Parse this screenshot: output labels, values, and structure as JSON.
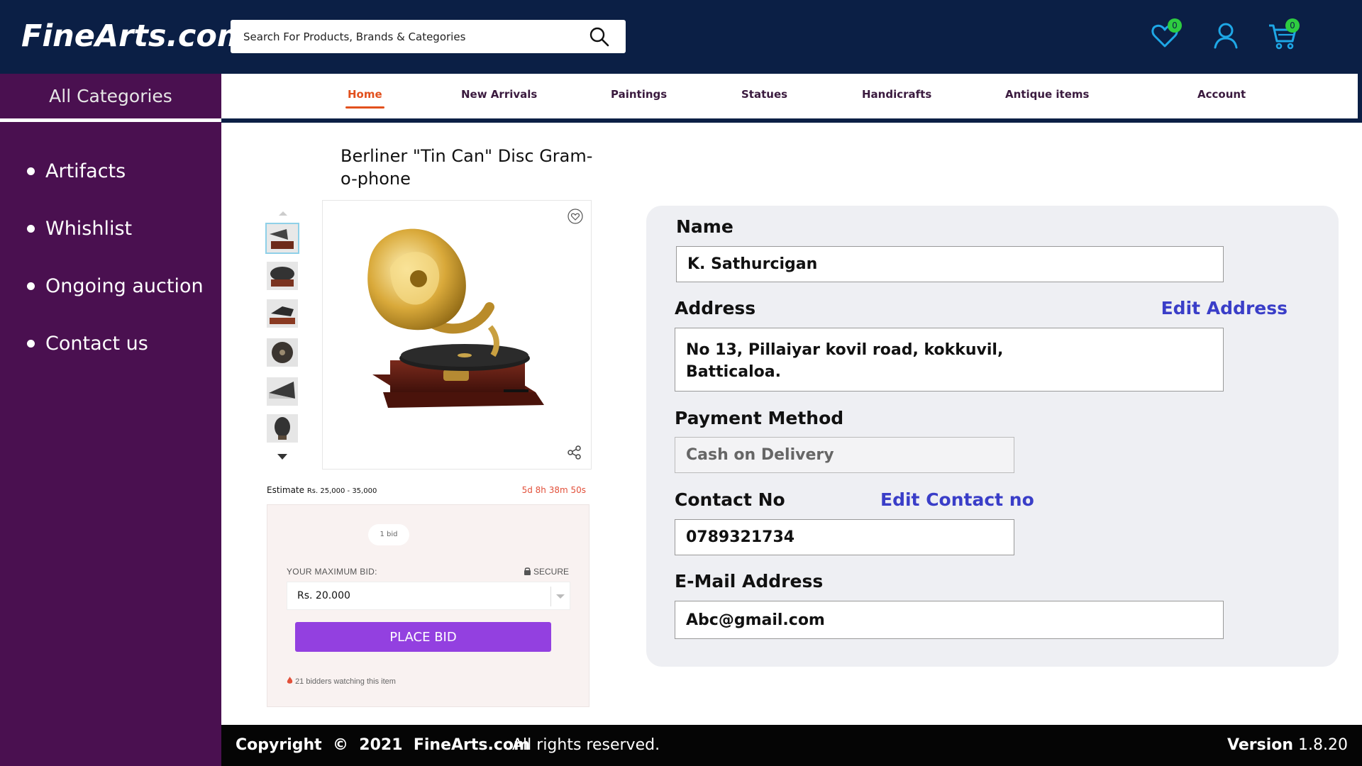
{
  "header": {
    "logo": "FineArts.com",
    "search_placeholder": "Search For Products, Brands & Categories",
    "wishlist_count": "0",
    "cart_count": "0"
  },
  "sidebar": {
    "all_categories": "All Categories",
    "items": [
      {
        "label": "Artifacts"
      },
      {
        "label": "Whishlist"
      },
      {
        "label": "Ongoing auction"
      },
      {
        "label": "Contact us"
      }
    ]
  },
  "nav": {
    "items": [
      {
        "label": "Home",
        "active": true
      },
      {
        "label": "New Arrivals"
      },
      {
        "label": "Paintings"
      },
      {
        "label": "Statues"
      },
      {
        "label": "Handicrafts"
      },
      {
        "label": "Antique items"
      },
      {
        "label": "Account"
      }
    ]
  },
  "product": {
    "title": "Berliner \"Tin Can\" Disc Gram-o-phone",
    "estimate_label": "Estimate",
    "estimate_value": "Rs. 25,000 - 35,000",
    "time_left": "5d 8h 38m 50s",
    "bids": "1 bid",
    "max_bid_label": "YOUR MAXIMUM BID:",
    "secure_label": "SECURE",
    "max_bid_value": "Rs. 20.000",
    "place_bid": "PLACE BID",
    "watching": "21 bidders watching this item"
  },
  "form": {
    "name_label": "Name",
    "name_value": "K. Sathurcigan",
    "address_label": "Address",
    "edit_address": "Edit Address",
    "address_line1": "No 13, Pillaiyar kovil road, kokkuvil,",
    "address_line2": "Batticaloa.",
    "payment_label": "Payment Method",
    "payment_value": "Cash on Delivery",
    "contact_label": "Contact No",
    "edit_contact": "Edit Contact no",
    "contact_value": "0789321734",
    "email_label": "E-Mail Address",
    "email_value": "Abc@gmail.com"
  },
  "footer": {
    "copyright": "Copyright  ©  2021  FineArts.com",
    "rights": "All rights reserved.",
    "version_label": "Version",
    "version_value": "1.8.20"
  },
  "colors": {
    "header_bg": "#0b1f45",
    "sidebar_bg": "#4a1050",
    "accent_orange": "#e2501d",
    "bid_button": "#9340e0",
    "link_blue": "#3a3ec8",
    "icon_cyan": "#1ea7e6"
  }
}
